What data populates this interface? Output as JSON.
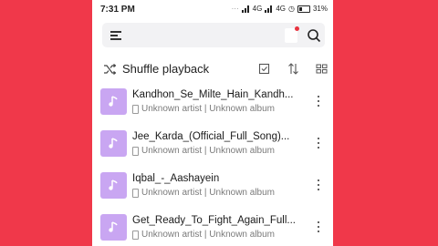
{
  "status": {
    "time": "7:31 PM",
    "network1": "4G",
    "network2": "4G",
    "battery": "31%"
  },
  "colors": {
    "background": "#f0384a",
    "album_art": "#c9a6f2",
    "notification_dot": "#e8333f"
  },
  "toolbar": {
    "shuffle_label": "Shuffle playback"
  },
  "songs": [
    {
      "title": "Kandhon_Se_Milte_Hain_Kandh...",
      "subtitle": "Unknown artist | Unknown album"
    },
    {
      "title": "Jee_Karda_(Official_Full_Song)...",
      "subtitle": "Unknown artist | Unknown album"
    },
    {
      "title": "Iqbal_-_Aashayein",
      "subtitle": "Unknown artist | Unknown album"
    },
    {
      "title": "Get_Ready_To_Fight_Again_Full...",
      "subtitle": "Unknown artist | Unknown album"
    }
  ]
}
